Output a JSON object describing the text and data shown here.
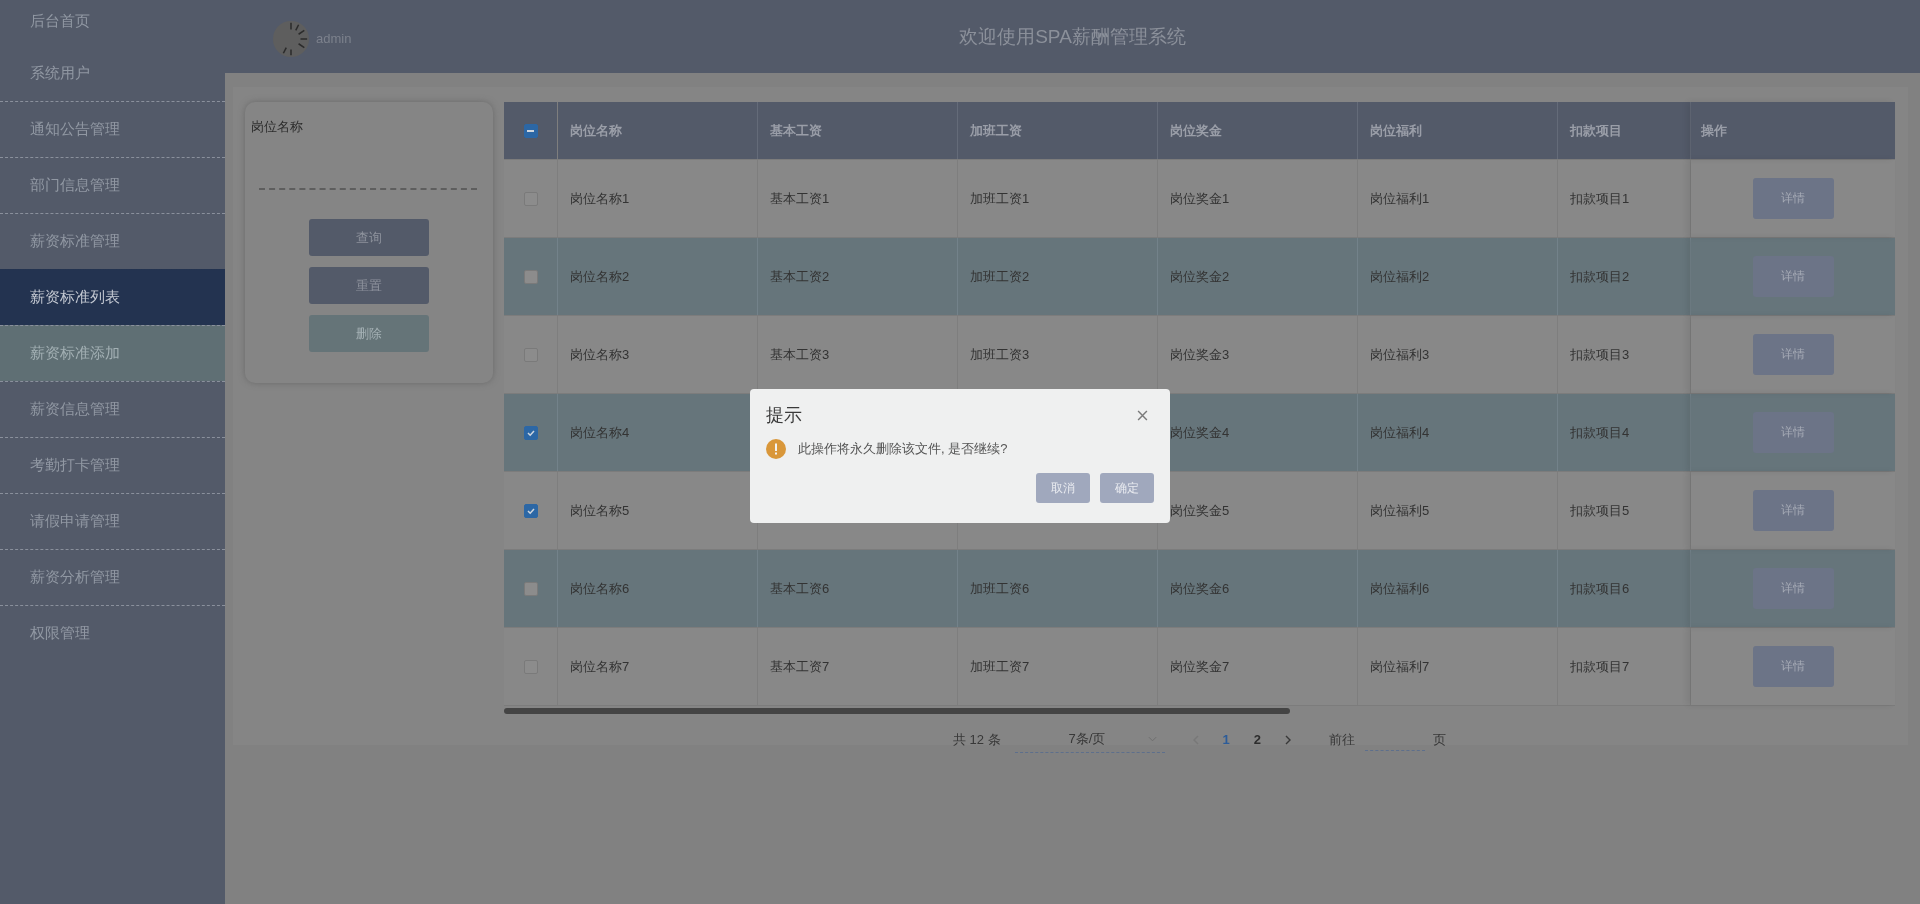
{
  "sidebar": {
    "items": [
      {
        "label": "后台首页",
        "selected": false,
        "hovered": false
      },
      {
        "label": "系统用户",
        "selected": false,
        "hovered": false
      },
      {
        "label": "通知公告管理",
        "selected": false,
        "hovered": false
      },
      {
        "label": "部门信息管理",
        "selected": false,
        "hovered": false
      },
      {
        "label": "薪资标准管理",
        "selected": false,
        "hovered": false
      },
      {
        "label": "薪资标准列表",
        "selected": true,
        "hovered": false
      },
      {
        "label": "薪资标准添加",
        "selected": false,
        "hovered": true
      },
      {
        "label": "薪资信息管理",
        "selected": false,
        "hovered": false
      },
      {
        "label": "考勤打卡管理",
        "selected": false,
        "hovered": false
      },
      {
        "label": "请假申请管理",
        "selected": false,
        "hovered": false
      },
      {
        "label": "薪资分析管理",
        "selected": false,
        "hovered": false
      },
      {
        "label": "权限管理",
        "selected": false,
        "hovered": false
      }
    ]
  },
  "header": {
    "username": "admin",
    "title": "欢迎使用SPA薪酬管理系统"
  },
  "search": {
    "label": "岗位名称",
    "buttons": [
      {
        "label": "查询",
        "kind": "primary"
      },
      {
        "label": "重置",
        "kind": "primary"
      },
      {
        "label": "删除",
        "kind": "danger"
      }
    ]
  },
  "table": {
    "select_all": {
      "indeterminate": true
    },
    "columns": [
      "岗位名称",
      "基本工资",
      "加班工资",
      "岗位奖金",
      "岗位福利",
      "扣款项目",
      "操作"
    ],
    "rows": [
      {
        "checked": false,
        "cells": [
          "岗位名称1",
          "基本工资1",
          "加班工资1",
          "岗位奖金1",
          "岗位福利1",
          "扣款项目1"
        ],
        "action": "详情"
      },
      {
        "checked": false,
        "cells": [
          "岗位名称2",
          "基本工资2",
          "加班工资2",
          "岗位奖金2",
          "岗位福利2",
          "扣款项目2"
        ],
        "action": "详情"
      },
      {
        "checked": false,
        "cells": [
          "岗位名称3",
          "基本工资3",
          "加班工资3",
          "岗位奖金3",
          "岗位福利3",
          "扣款项目3"
        ],
        "action": "详情"
      },
      {
        "checked": true,
        "cells": [
          "岗位名称4",
          "",
          "",
          "岗位奖金4",
          "岗位福利4",
          "扣款项目4"
        ],
        "action": "详情"
      },
      {
        "checked": true,
        "cells": [
          "岗位名称5",
          "",
          "",
          "岗位奖金5",
          "岗位福利5",
          "扣款项目5"
        ],
        "action": "详情"
      },
      {
        "checked": false,
        "cells": [
          "岗位名称6",
          "基本工资6",
          "加班工资6",
          "岗位奖金6",
          "岗位福利6",
          "扣款项目6"
        ],
        "action": "详情"
      },
      {
        "checked": false,
        "cells": [
          "岗位名称7",
          "基本工资7",
          "加班工资7",
          "岗位奖金7",
          "岗位福利7",
          "扣款项目7"
        ],
        "action": "详情"
      }
    ]
  },
  "pagination": {
    "total": "共 12 条",
    "page_size": "7条/页",
    "prev_disabled": true,
    "pages": [
      {
        "label": "1",
        "selected": true
      },
      {
        "label": "2",
        "selected": false
      }
    ],
    "goto_label": "前往",
    "goto_suffix": "页"
  },
  "dialog": {
    "title": "提示",
    "message": "此操作将永久删除该文件, 是否继续?",
    "buttons": [
      "取消",
      "确定"
    ]
  }
}
